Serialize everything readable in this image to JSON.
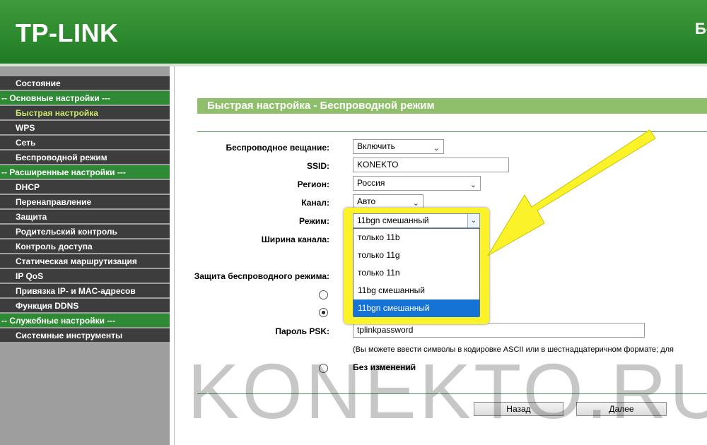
{
  "header": {
    "logo": "TP-LINK",
    "right_text": "Бе"
  },
  "sidebar": {
    "items": [
      {
        "type": "item",
        "label": "Состояние"
      },
      {
        "type": "section",
        "label": "-- Основные настройки ---"
      },
      {
        "type": "item",
        "label": "Быстрая настройка",
        "active": true
      },
      {
        "type": "item",
        "label": "WPS"
      },
      {
        "type": "item",
        "label": "Сеть"
      },
      {
        "type": "item",
        "label": "Беспроводной режим"
      },
      {
        "type": "section",
        "label": "-- Расширенные настройки ---"
      },
      {
        "type": "item",
        "label": "DHCP"
      },
      {
        "type": "item",
        "label": "Перенаправление"
      },
      {
        "type": "item",
        "label": "Защита"
      },
      {
        "type": "item",
        "label": "Родительский контроль"
      },
      {
        "type": "item",
        "label": "Контроль доступа"
      },
      {
        "type": "item",
        "label": "Статическая маршрутизация"
      },
      {
        "type": "item",
        "label": "IP QoS"
      },
      {
        "type": "item",
        "label": "Привязка IP- и MAC-адресов"
      },
      {
        "type": "item",
        "label": "Функция DDNS"
      },
      {
        "type": "section",
        "label": "-- Служебные настройки ---"
      },
      {
        "type": "item",
        "label": "Системные инструменты"
      }
    ]
  },
  "main": {
    "title": "Быстрая настройка - Беспроводной режим",
    "broadcast": {
      "label": "Беспроводное вещание:",
      "value": "Включить"
    },
    "ssid": {
      "label": "SSID:",
      "value": "KONEKTO"
    },
    "region": {
      "label": "Регион:",
      "value": "Россия"
    },
    "channel": {
      "label": "Канал:",
      "value": "Авто"
    },
    "mode": {
      "label": "Режим:",
      "value": "11bgn смешанный",
      "options": [
        "только 11b",
        "только 11g",
        "только 11n",
        "11bg смешанный",
        "11bgn смешанный"
      ],
      "selected_index": 4
    },
    "channel_width": {
      "label": "Ширина канала:"
    },
    "security": {
      "label": "Защита беспроводного режима:"
    },
    "psk": {
      "label": "Пароль PSK:",
      "value": "tplinkpassword"
    },
    "hint": "(Вы можете ввести символы в кодировке ASCII или в шестнадцатеричном формате; для",
    "no_change": "Без изменений",
    "back_button": "Назад",
    "next_button": "Далее"
  },
  "watermark": "KONEKTO.RU",
  "colors": {
    "header_green": "#2e8a2e",
    "section_green": "#2f8a36",
    "menu_dark": "#3d3d3d",
    "active_item": "#c9e86a",
    "title_bar": "#8fbf6a",
    "highlight_yellow": "#fbf22a",
    "selected_option": "#1673d6"
  }
}
